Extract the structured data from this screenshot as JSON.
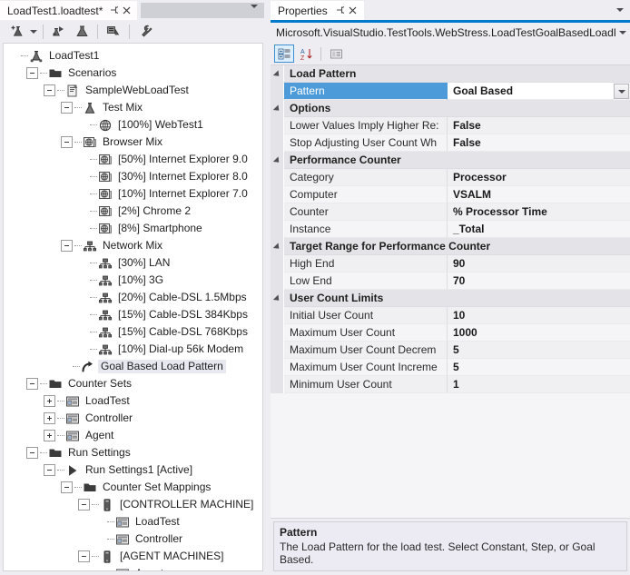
{
  "editor_tab": {
    "title": "LoadTest1.loadtest*",
    "pin_icon": "pin-icon",
    "close_icon": "close-icon"
  },
  "editor_toolbar": {
    "buttons": [
      {
        "name": "add-load-test-item",
        "icon": "flask-add-icon"
      },
      {
        "name": "add-dropdown",
        "icon": "chevron-down-icon"
      },
      {
        "name": "run-load-test",
        "icon": "flask-run-icon"
      },
      {
        "name": "manage-test-mix",
        "icon": "flask-icon"
      },
      {
        "name": "manage-counter-sets",
        "icon": "counters-icon"
      },
      {
        "name": "load-test-settings",
        "icon": "wrench-icon"
      }
    ]
  },
  "tree": [
    {
      "depth": 0,
      "toggle": "none",
      "icon": "load-test-icon",
      "label": "LoadTest1",
      "selected": false
    },
    {
      "depth": 1,
      "toggle": "minus",
      "icon": "folder-icon",
      "label": "Scenarios",
      "selected": false
    },
    {
      "depth": 2,
      "toggle": "minus",
      "icon": "scenario-icon",
      "label": "SampleWebLoadTest",
      "selected": false
    },
    {
      "depth": 3,
      "toggle": "minus",
      "icon": "flask-icon",
      "label": "Test Mix",
      "selected": false
    },
    {
      "depth": 4,
      "toggle": "none",
      "icon": "web-test-icon",
      "label": "[100%] WebTest1",
      "selected": false
    },
    {
      "depth": 3,
      "toggle": "minus",
      "icon": "browser-mix-icon",
      "label": "Browser Mix",
      "selected": false
    },
    {
      "depth": 4,
      "toggle": "none",
      "icon": "browser-icon",
      "label": "[50%] Internet Explorer 9.0",
      "selected": false
    },
    {
      "depth": 4,
      "toggle": "none",
      "icon": "browser-icon",
      "label": "[30%] Internet Explorer 8.0",
      "selected": false
    },
    {
      "depth": 4,
      "toggle": "none",
      "icon": "browser-icon",
      "label": "[10%] Internet Explorer 7.0",
      "selected": false
    },
    {
      "depth": 4,
      "toggle": "none",
      "icon": "browser-icon",
      "label": "[2%] Chrome 2",
      "selected": false
    },
    {
      "depth": 4,
      "toggle": "none",
      "icon": "browser-icon",
      "label": "[8%] Smartphone",
      "selected": false
    },
    {
      "depth": 3,
      "toggle": "minus",
      "icon": "network-icon",
      "label": "Network Mix",
      "selected": false
    },
    {
      "depth": 4,
      "toggle": "none",
      "icon": "network-icon",
      "label": "[30%] LAN",
      "selected": false
    },
    {
      "depth": 4,
      "toggle": "none",
      "icon": "network-icon",
      "label": "[10%] 3G",
      "selected": false
    },
    {
      "depth": 4,
      "toggle": "none",
      "icon": "network-icon",
      "label": "[20%] Cable-DSL 1.5Mbps",
      "selected": false
    },
    {
      "depth": 4,
      "toggle": "none",
      "icon": "network-icon",
      "label": "[15%] Cable-DSL 384Kbps",
      "selected": false
    },
    {
      "depth": 4,
      "toggle": "none",
      "icon": "network-icon",
      "label": "[15%] Cable-DSL 768Kbps",
      "selected": false
    },
    {
      "depth": 4,
      "toggle": "none",
      "icon": "network-icon",
      "label": "[10%] Dial-up 56k Modem",
      "selected": false
    },
    {
      "depth": 3,
      "toggle": "none",
      "icon": "load-pattern-icon",
      "label": "Goal Based Load Pattern",
      "selected": true
    },
    {
      "depth": 1,
      "toggle": "minus",
      "icon": "folder-icon",
      "label": "Counter Sets",
      "selected": false
    },
    {
      "depth": 2,
      "toggle": "plus",
      "icon": "counter-set-icon",
      "label": "LoadTest",
      "selected": false
    },
    {
      "depth": 2,
      "toggle": "plus",
      "icon": "counter-set-icon",
      "label": "Controller",
      "selected": false
    },
    {
      "depth": 2,
      "toggle": "plus",
      "icon": "counter-set-icon",
      "label": "Agent",
      "selected": false
    },
    {
      "depth": 1,
      "toggle": "minus",
      "icon": "folder-icon",
      "label": "Run Settings",
      "selected": false
    },
    {
      "depth": 2,
      "toggle": "minus",
      "icon": "active-run-icon",
      "label": "Run Settings1 [Active]",
      "selected": false
    },
    {
      "depth": 3,
      "toggle": "minus",
      "icon": "folder-icon",
      "label": "Counter Set Mappings",
      "selected": false
    },
    {
      "depth": 4,
      "toggle": "minus",
      "icon": "machine-icon",
      "label": "[CONTROLLER MACHINE]",
      "selected": false
    },
    {
      "depth": 5,
      "toggle": "none",
      "icon": "counter-set-icon",
      "label": "LoadTest",
      "selected": false
    },
    {
      "depth": 5,
      "toggle": "none",
      "icon": "counter-set-icon",
      "label": "Controller",
      "selected": false
    },
    {
      "depth": 4,
      "toggle": "minus",
      "icon": "machine-icon",
      "label": "[AGENT MACHINES]",
      "selected": false
    },
    {
      "depth": 5,
      "toggle": "none",
      "icon": "counter-set-icon",
      "label": "Agent",
      "selected": false
    }
  ],
  "properties": {
    "tab_title": "Properties",
    "pin_icon": "pin-icon",
    "close_icon": "close-icon",
    "object_name": "Microsoft.VisualStudio.TestTools.WebStress.LoadTestGoalBasedLoadPro",
    "toolbar": [
      {
        "name": "categorized-view-button",
        "icon": "categorized-icon",
        "active": true
      },
      {
        "name": "alphabetical-sort-button",
        "icon": "sort-az-icon",
        "active": false
      },
      {
        "name": "property-pages-button",
        "icon": "property-pages-icon",
        "active": false
      }
    ],
    "groups": [
      {
        "name": "Load Pattern",
        "rows": [
          {
            "name": "Pattern",
            "value": "Goal Based",
            "selected": true,
            "dropdown": true
          }
        ]
      },
      {
        "name": "Options",
        "rows": [
          {
            "name": "Lower Values Imply Higher Re:",
            "value": "False",
            "selected": false,
            "dropdown": false
          },
          {
            "name": "Stop Adjusting User Count Wh",
            "value": "False",
            "selected": false,
            "dropdown": false
          }
        ]
      },
      {
        "name": "Performance Counter",
        "rows": [
          {
            "name": "Category",
            "value": "Processor",
            "selected": false,
            "dropdown": false
          },
          {
            "name": "Computer",
            "value": "VSALM",
            "selected": false,
            "dropdown": false
          },
          {
            "name": "Counter",
            "value": "% Processor Time",
            "selected": false,
            "dropdown": false
          },
          {
            "name": "Instance",
            "value": "_Total",
            "selected": false,
            "dropdown": false
          }
        ]
      },
      {
        "name": "Target Range for Performance Counter",
        "rows": [
          {
            "name": "High End",
            "value": "90",
            "selected": false,
            "dropdown": false
          },
          {
            "name": "Low End",
            "value": "70",
            "selected": false,
            "dropdown": false
          }
        ]
      },
      {
        "name": "User Count Limits",
        "rows": [
          {
            "name": "Initial User Count",
            "value": "10",
            "selected": false,
            "dropdown": false
          },
          {
            "name": "Maximum User Count",
            "value": "1000",
            "selected": false,
            "dropdown": false
          },
          {
            "name": "Maximum User Count Decrem",
            "value": "5",
            "selected": false,
            "dropdown": false
          },
          {
            "name": "Maximum User Count Increme",
            "value": "5",
            "selected": false,
            "dropdown": false
          },
          {
            "name": "Minimum User Count",
            "value": "1",
            "selected": false,
            "dropdown": false
          }
        ]
      }
    ],
    "description": {
      "title": "Pattern",
      "text": "The Load Pattern for the load test. Select Constant, Step, or Goal  Based."
    }
  },
  "colors": {
    "accent": "#007acc",
    "selection": "#4e9bd9",
    "chrome": "#eeeef2",
    "grid_bg": "#f5f5f7"
  }
}
